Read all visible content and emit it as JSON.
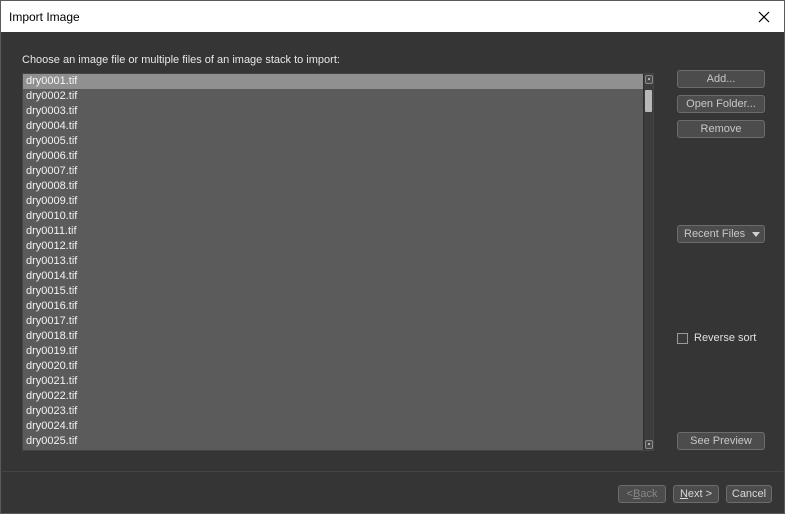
{
  "window": {
    "title": "Import Image",
    "close_icon": "close-icon"
  },
  "instruction": "Choose an image file or multiple files of an image stack to import:",
  "files": [
    "dry0001.tif",
    "dry0002.tif",
    "dry0003.tif",
    "dry0004.tif",
    "dry0005.tif",
    "dry0006.tif",
    "dry0007.tif",
    "dry0008.tif",
    "dry0009.tif",
    "dry0010.tif",
    "dry0011.tif",
    "dry0012.tif",
    "dry0013.tif",
    "dry0014.tif",
    "dry0015.tif",
    "dry0016.tif",
    "dry0017.tif",
    "dry0018.tif",
    "dry0019.tif",
    "dry0020.tif",
    "dry0021.tif",
    "dry0022.tif",
    "dry0023.tif",
    "dry0024.tif",
    "dry0025.tif"
  ],
  "selected_file": "dry0001.tif",
  "side_buttons": {
    "add": "Add...",
    "open_folder": "Open Folder...",
    "remove": "Remove",
    "recent_files": "Recent Files",
    "see_preview": "See Preview"
  },
  "reverse_sort": {
    "label": "Reverse sort",
    "checked": false
  },
  "footer": {
    "back_prefix": "< ",
    "back_mnemonic": "B",
    "back_rest": "ack",
    "next_mnemonic": "N",
    "next_rest": "ext >",
    "cancel": "Cancel"
  },
  "colors": {
    "background": "#353535",
    "list_background": "#5b5b5b",
    "selection": "#909090"
  }
}
